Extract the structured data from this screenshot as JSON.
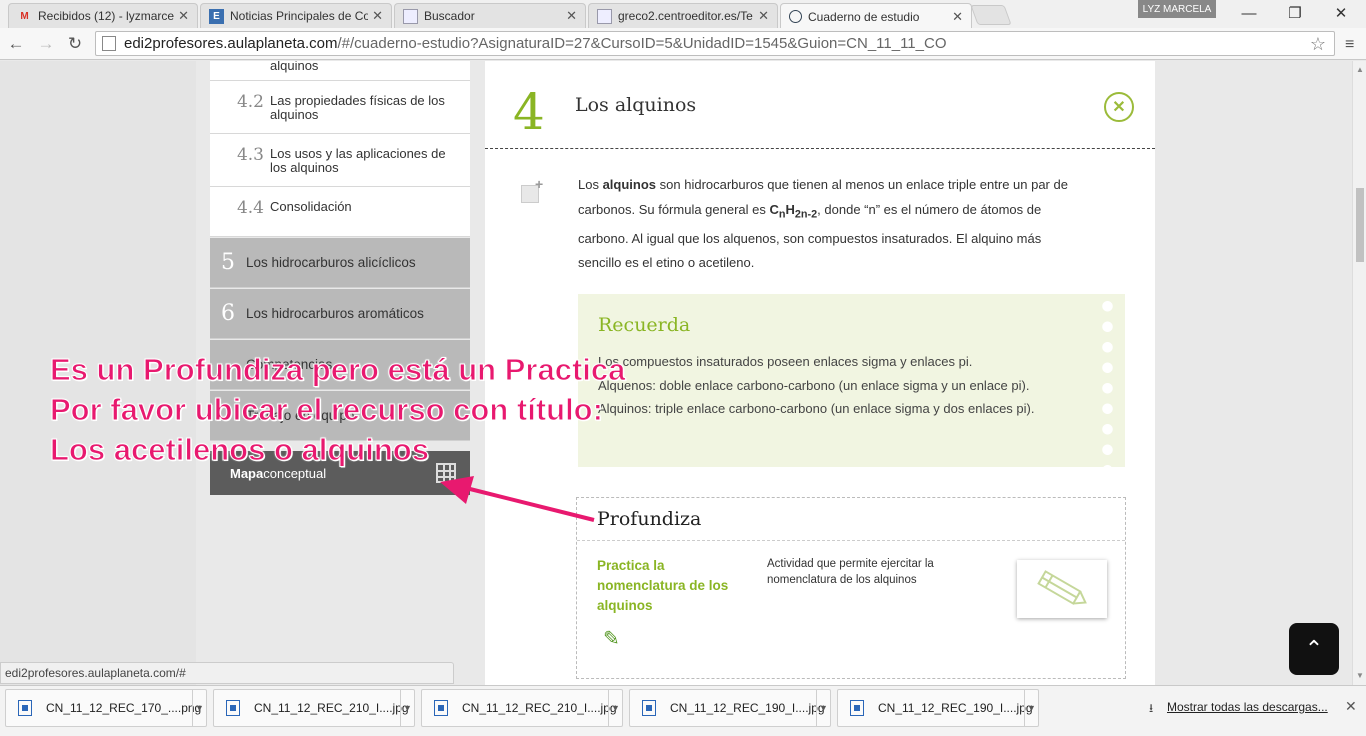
{
  "browser": {
    "tabs": [
      {
        "title": "Recibidos (12) - lyzmarcel",
        "icon": "gmail-icon"
      },
      {
        "title": "Noticias Principales de Co",
        "icon": "news-icon"
      },
      {
        "title": "Buscador",
        "icon": "page-icon"
      },
      {
        "title": "greco2.centroeditor.es/Te",
        "icon": "page-icon"
      },
      {
        "title": "Cuaderno de estudio",
        "icon": "globe-icon"
      }
    ],
    "user": "LYZ MARCELA",
    "url_domain": "edi2profesores.aulaplaneta.com",
    "url_path": "/#/cuaderno-estudio?AsignaturaID=27&CursoID=5&UnidadID=1545&Guion=CN_11_11_CO"
  },
  "sidebar": {
    "partial_item": "alquinos",
    "items": [
      {
        "num": "4.2",
        "label": "Las propiedades físicas de los alquinos"
      },
      {
        "num": "4.3",
        "label": "Los usos y las aplicaciones de los alquinos"
      },
      {
        "num": "4.4",
        "label": "Consolidación"
      }
    ],
    "sections": [
      {
        "num": "5",
        "label": "Los hidrocarburos alicíclicos"
      },
      {
        "num": "6",
        "label": "Los hidrocarburos aromáticos"
      },
      {
        "num": "",
        "label": "Competencias"
      },
      {
        "num": "",
        "label": "Trabajo en equipo"
      }
    ],
    "map_bold": "Mapa",
    "map_rest": " conceptual"
  },
  "chapter": {
    "number": "4",
    "title": "Los alquinos",
    "intro_pre": "Los ",
    "intro_bold": "alquinos",
    "intro_mid": " son hidrocarburos que tienen al menos un enlace triple entre un par de carbonos. Su fórmula general es ",
    "formula": "CnH2n-2",
    "intro_post": ", donde “n” es el número de átomos de carbono. Al igual que los alquenos, son compuestos insaturados. El alquino más sencillo es el etino o acetileno."
  },
  "recuerda": {
    "title": "Recuerda",
    "line1": "Los compuestos insaturados poseen enlaces sigma y enlaces pi.",
    "line2": "Alquenos: doble enlace carbono-carbono (un enlace sigma y un enlace pi). Alquinos: triple enlace carbono-carbono (un enlace sigma y dos enlaces pi)."
  },
  "profundiza": {
    "title": "Profundiza",
    "resource_title": "Practica la nomenclatura de los alquinos",
    "resource_desc": "Actividad que permite ejercitar la nomenclatura de los alquinos"
  },
  "status_url": "edi2profesores.aulaplaneta.com/#",
  "annotation": {
    "line1": "Es un Profundiza pero está un Practica",
    "line2": "Por favor ubicar el recurso con título:",
    "line3": "Los acetilenos o alquinos",
    "color": "#e8196f"
  },
  "downloads": {
    "items": [
      "CN_11_12_REC_170_....png",
      "CN_11_12_REC_210_I....jpg",
      "CN_11_12_REC_210_I....jpg",
      "CN_11_12_REC_190_I....jpg",
      "CN_11_12_REC_190_I....jpg"
    ],
    "show_all": "Mostrar todas las descargas..."
  },
  "colors": {
    "accent": "#8ab524",
    "recuerda_bg": "#f1f5e1"
  }
}
